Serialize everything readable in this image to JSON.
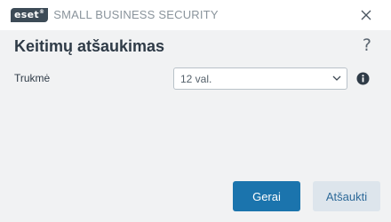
{
  "window": {
    "brand_logo": "eset",
    "product_name": "SMALL BUSINESS SECURITY",
    "close_icon": "close-icon"
  },
  "dialog": {
    "title": "Keitimų atšaukimas",
    "help_label": "?",
    "field": {
      "label": "Trukmė",
      "selected_value": "12 val.",
      "info_icon": "info-icon"
    }
  },
  "buttons": {
    "ok_label": "Gerai",
    "cancel_label": "Atšaukti"
  },
  "colors": {
    "primary_button": "#1b74ad",
    "secondary_button": "#dde5ec",
    "logo": "#3d4b57",
    "background": "#f1f2f3"
  }
}
